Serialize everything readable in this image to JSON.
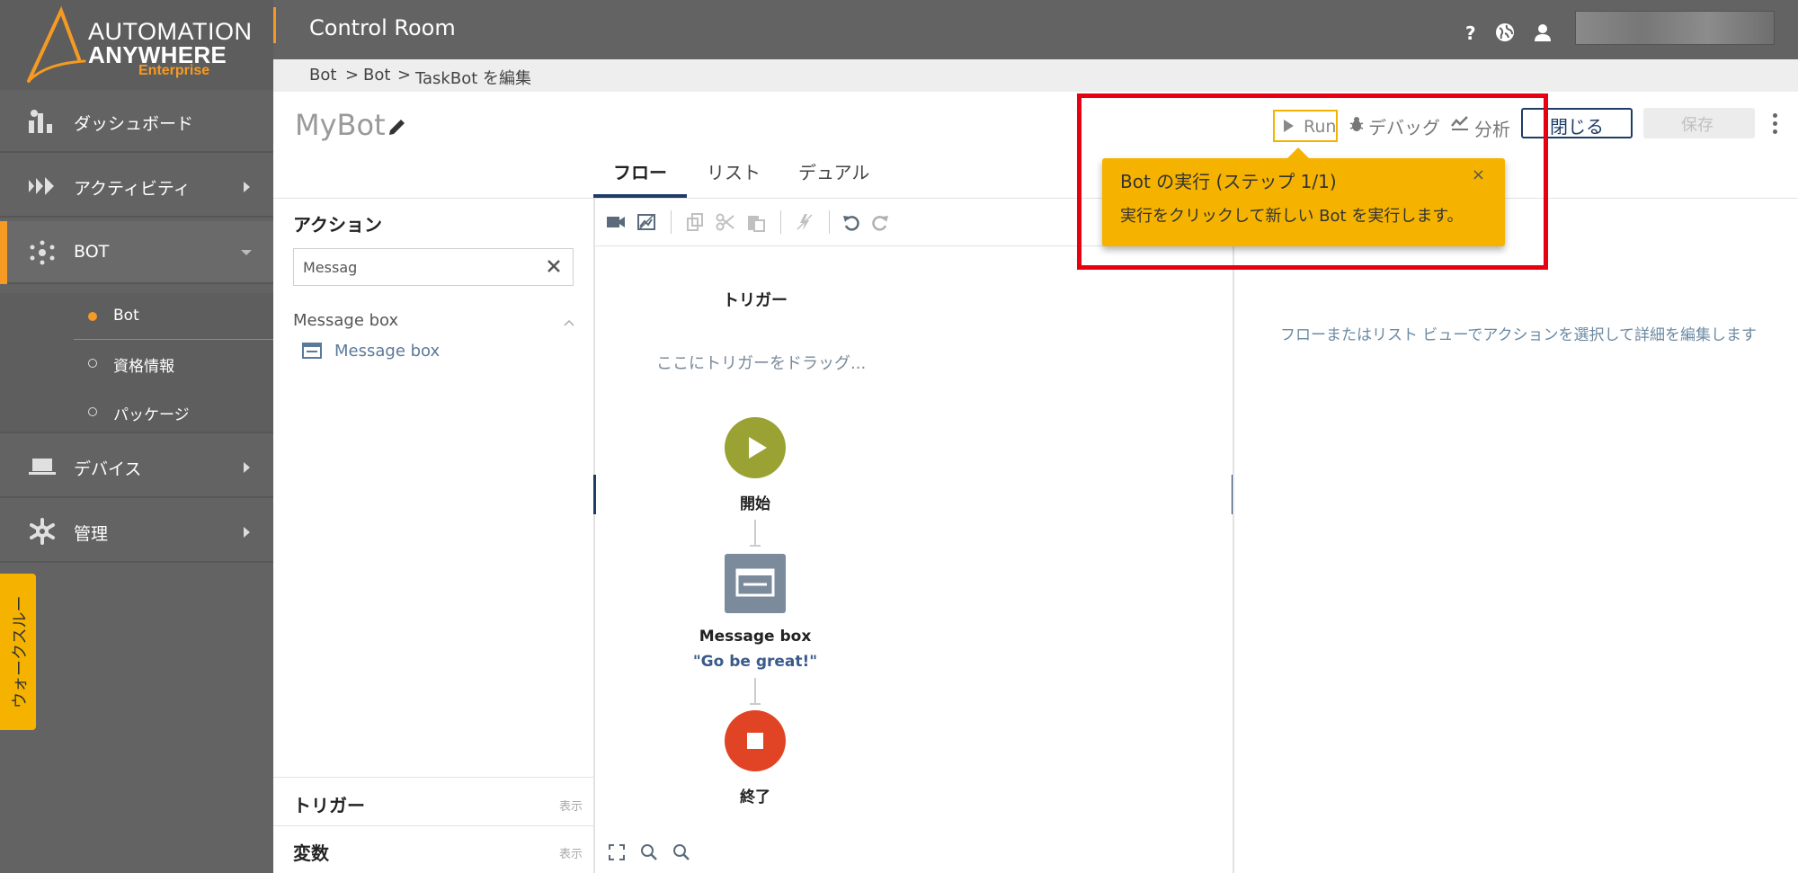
{
  "brand": {
    "line1": "AUTOMATION",
    "line2": "ANYWHERE",
    "line3": "Enterprise",
    "accent_color": "#f59a23"
  },
  "header": {
    "title": "Control Room",
    "icons": [
      "help-icon",
      "globe-icon",
      "user-icon"
    ]
  },
  "breadcrumb": [
    "Bot",
    ">",
    "Bot",
    ">",
    "TaskBot を編集"
  ],
  "sidebar": {
    "items": [
      {
        "label": "ダッシュボード",
        "icon": "dashboard-icon"
      },
      {
        "label": "アクティビティ",
        "icon": "activity-icon"
      },
      {
        "label": "BOT",
        "icon": "bot-icon"
      },
      {
        "label": "デバイス",
        "icon": "devices-icon"
      },
      {
        "label": "管理",
        "icon": "gear-icon"
      }
    ],
    "subitems": [
      {
        "label": "Bot",
        "selected": true
      },
      {
        "label": "資格情報",
        "selected": false
      },
      {
        "label": "パッケージ",
        "selected": false
      }
    ],
    "walkthrough_label": "ウォークスルー"
  },
  "editor": {
    "bot_name": "MyBot",
    "run_label": "Run",
    "debug_label": "デバッグ",
    "analyze_label": "分析",
    "close_label": "閉じる",
    "save_label": "保存",
    "tabs": [
      "フロー",
      "リスト",
      "デュアル"
    ],
    "active_tab": "フロー"
  },
  "actions_panel": {
    "title": "アクション",
    "search_value": "Messag",
    "group_label": "Message box",
    "item_label": "Message box",
    "triggers_label": "トリガー",
    "triggers_toggle": "表示",
    "variables_label": "変数",
    "variables_toggle": "表示"
  },
  "flow": {
    "trigger_title": "トリガー",
    "trigger_placeholder": "ここにトリガーをドラッグ...",
    "start_label": "開始",
    "start_color": "#9aa233",
    "action_label": "Message box",
    "action_sub": "\"Go be great!\"",
    "end_label": "終了",
    "end_color": "#e04424"
  },
  "details_hint": "フローまたはリスト ビューでアクションを選択して詳細を編集します",
  "tooltip": {
    "title": "Bot の実行 (ステップ 1/1)",
    "body": "実行をクリックして新しい Bot を実行します。",
    "close": "×",
    "color": "#f5b300"
  },
  "highlight_color": "#e60012"
}
